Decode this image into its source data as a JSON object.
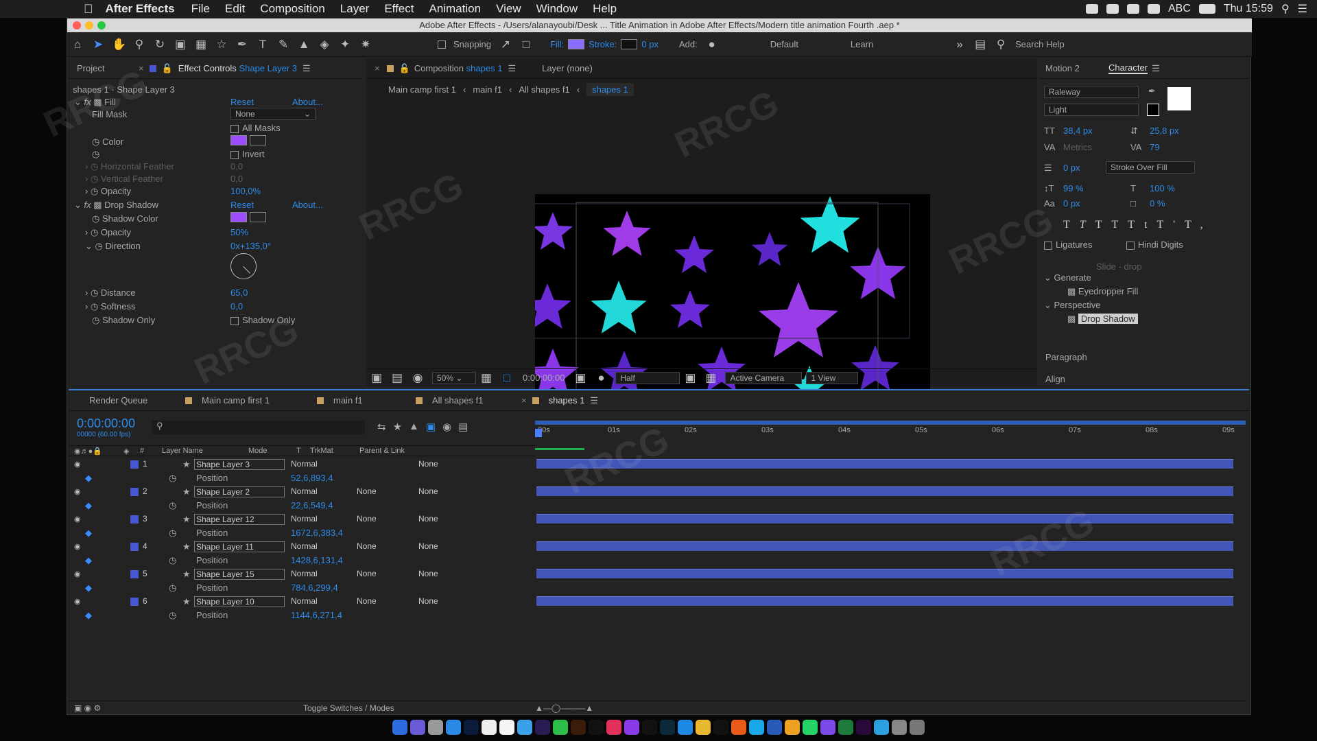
{
  "menubar": {
    "app": "After Effects",
    "items": [
      "File",
      "Edit",
      "Composition",
      "Layer",
      "Effect",
      "Animation",
      "View",
      "Window",
      "Help"
    ],
    "input_indicator": "ABC",
    "clock": "Thu 15:59"
  },
  "window": {
    "title": "Adobe After Effects - /Users/alanayoubi/Desk ... Title Animation in Adobe After Effects/Modern title animation Fourth .aep *"
  },
  "toolbar": {
    "snapping": "Snapping",
    "fill": "Fill:",
    "stroke": "Stroke:",
    "stroke_px": "0 px",
    "add": "Add:",
    "workspace_default": "Default",
    "workspace_learn": "Learn",
    "search_placeholder": "Search Help"
  },
  "left_panel": {
    "tab_project": "Project",
    "tab_effect_controls": "Effect Controls",
    "tab_layer": "Shape Layer 3",
    "breadcrumb": "shapes 1 · Shape Layer 3",
    "fill": {
      "name": "Fill",
      "reset": "Reset",
      "about": "About...",
      "fill_mask_label": "Fill Mask",
      "fill_mask_value": "None",
      "all_masks": "All Masks",
      "color_label": "Color",
      "invert": "Invert",
      "hfeather_label": "Horizontal Feather",
      "hfeather_value": "0,0",
      "vfeather_label": "Vertical Feather",
      "vfeather_value": "0,0",
      "opacity_label": "Opacity",
      "opacity_value": "100,0%"
    },
    "shadow": {
      "name": "Drop Shadow",
      "reset": "Reset",
      "about": "About...",
      "color_label": "Shadow Color",
      "opacity_label": "Opacity",
      "opacity_value": "50%",
      "direction_label": "Direction",
      "direction_value": "0x+135,0°",
      "distance_label": "Distance",
      "distance_value": "65,0",
      "softness_label": "Softness",
      "softness_value": "0,0",
      "only_label": "Shadow Only",
      "only_checkbox": "Shadow Only"
    },
    "swatch_color": "#9b4dff"
  },
  "comp_panel": {
    "tab_comp": "Composition",
    "tab_comp_name": "shapes 1",
    "tab_layer": "Layer (none)",
    "crumbs": [
      "Main camp first 1",
      "main f1",
      "All shapes f1",
      "shapes 1"
    ],
    "footer": {
      "zoom": "50%",
      "time": "0:00:00:00",
      "resolution": "Half",
      "camera": "Active Camera",
      "views": "1 View"
    }
  },
  "right_panel": {
    "tab_motion": "Motion 2",
    "tab_character": "Character",
    "font": "Raleway",
    "style": "Light",
    "size": "38,4 px",
    "leading": "25,8 px",
    "kerning": "Metrics",
    "tracking": "79",
    "stroke_width": "0 px",
    "stroke_type": "Stroke Over Fill",
    "vscale": "99 %",
    "hscale": "100 %",
    "baseline": "0 px",
    "tsume": "0 %",
    "ligatures": "Ligatures",
    "hindi": "Hindi Digits",
    "tree_partial": "Slide - drop",
    "generate": "Generate",
    "eyedropper": "Eyedropper Fill",
    "perspective": "Perspective",
    "drop_shadow": "Drop Shadow",
    "paragraph": "Paragraph",
    "align": "Align"
  },
  "timeline": {
    "tabs": [
      "Render Queue",
      "Main camp first 1",
      "main f1",
      "All shapes f1",
      "shapes 1"
    ],
    "timecode": "0:00:00:00",
    "fps": "00000 (60.00 fps)",
    "headers": {
      "layer_name": "Layer Name",
      "mode": "Mode",
      "t": "T",
      "trkmat": "TrkMat",
      "parent": "Parent & Link"
    },
    "ruler": [
      "00s",
      "01s",
      "02s",
      "03s",
      "04s",
      "05s",
      "06s",
      "07s",
      "08s",
      "09s"
    ],
    "layers": [
      {
        "num": "1",
        "name": "Shape Layer 3",
        "mode": "Normal",
        "trkmat": "",
        "parent": "None",
        "position": "52,6,893,4"
      },
      {
        "num": "2",
        "name": "Shape Layer 2",
        "mode": "Normal",
        "trkmat": "None",
        "parent": "None",
        "position": "22,6,549,4"
      },
      {
        "num": "3",
        "name": "Shape Layer 12",
        "mode": "Normal",
        "trkmat": "None",
        "parent": "None",
        "position": "1672,6,383,4"
      },
      {
        "num": "4",
        "name": "Shape Layer 11",
        "mode": "Normal",
        "trkmat": "None",
        "parent": "None",
        "position": "1428,6,131,4"
      },
      {
        "num": "5",
        "name": "Shape Layer 15",
        "mode": "Normal",
        "trkmat": "None",
        "parent": "None",
        "position": "784,6,299,4"
      },
      {
        "num": "6",
        "name": "Shape Layer 10",
        "mode": "Normal",
        "trkmat": "None",
        "parent": "None",
        "position": "1144,6,271,4"
      }
    ],
    "position_label": "Position",
    "toggle": "Toggle Switches / Modes"
  },
  "watermark": "RRCG"
}
